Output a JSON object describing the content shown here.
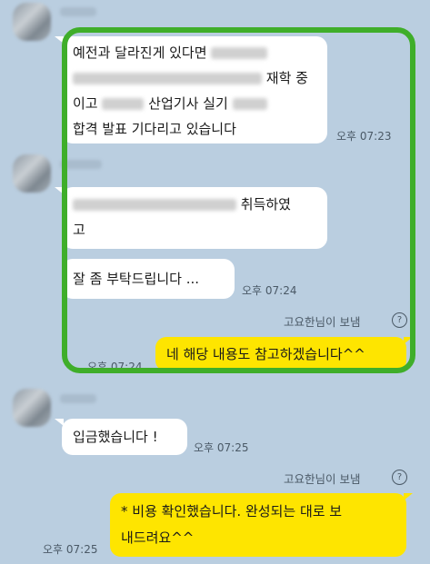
{
  "messages": {
    "m1": {
      "line1": "예전과 달라진게 있다면",
      "line2": "재학 중",
      "line3a": "이고",
      "line3b": "산업기사 실기",
      "line4": "합격 발표 기다리고 있습니다",
      "time": "오후 07:23"
    },
    "m2": {
      "line1": "취득하였",
      "line2": "고"
    },
    "m3": {
      "text": "잘 좀 부탁드립니다 ...",
      "time": "오후 07:24"
    },
    "sent1": {
      "sender": "고요한님이 보냄",
      "help": "?",
      "text": "네 해당 내용도 참고하겠습니다^^",
      "time": "오후 07:24"
    },
    "m4": {
      "text": "입금했습니다 !",
      "time": "오후 07:25"
    },
    "sent2": {
      "sender": "고요한님이 보냄",
      "help": "?",
      "line1": "* 비용 확인했습니다. 완성되는 대로 보",
      "line2": "내드려요^^",
      "time": "오후 07:25"
    }
  },
  "colors": {
    "background": "#bacee0",
    "sent_bubble": "#fee500",
    "received_bubble": "#ffffff",
    "highlight": "#3fae2a"
  }
}
